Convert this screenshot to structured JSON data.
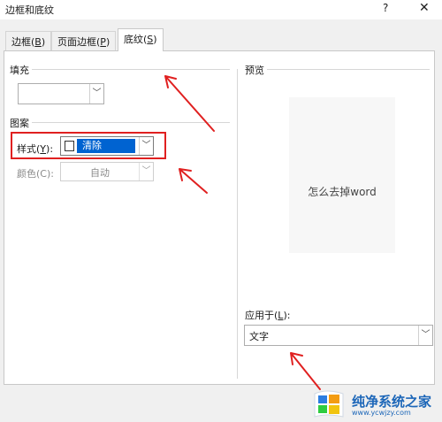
{
  "window": {
    "title": "边框和底纹",
    "help": "?",
    "close": "✕"
  },
  "tabs": [
    {
      "label": "边框(",
      "key": "B",
      "tail": ")",
      "active": false
    },
    {
      "label": "页面边框(",
      "key": "P",
      "tail": ")",
      "active": false
    },
    {
      "label": "底纹(",
      "key": "S",
      "tail": ")",
      "active": true
    }
  ],
  "fill": {
    "section": "填充",
    "value": ""
  },
  "pattern": {
    "section": "图案",
    "style_label": "样式(",
    "style_key": "Y",
    "style_tail": "):",
    "style_value": "清除",
    "color_label": "颜色(C):",
    "color_value": "自动"
  },
  "preview": {
    "section": "预览",
    "text": "怎么去掉word"
  },
  "apply": {
    "label": "应用于(",
    "key": "L",
    "tail": "):",
    "value": "文字"
  },
  "watermark": {
    "text": "纯净系统之家",
    "url": "www.ycwjzy.com"
  },
  "colors": {
    "accent": "#0063d1",
    "annotation": "#e02020"
  },
  "icons": {
    "dropdown": "chevron-down-icon",
    "close": "close-icon",
    "help": "help-icon"
  }
}
